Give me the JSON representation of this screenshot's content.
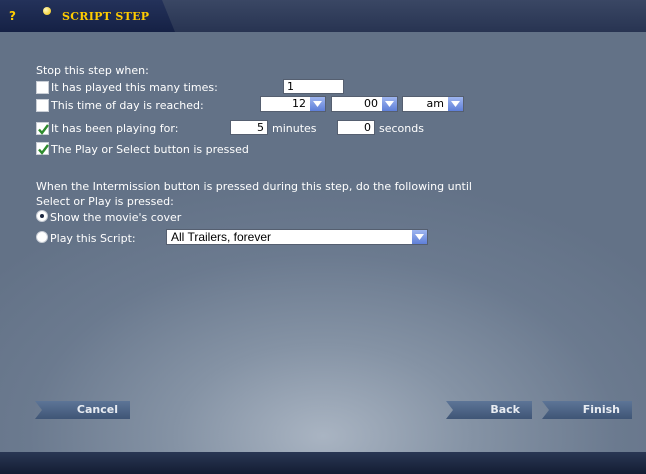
{
  "title": {
    "text": "SCRIPT STEP",
    "help_label": "?"
  },
  "stop_section": {
    "heading": "Stop this step when:",
    "played_times": {
      "label": "It has played this many times:",
      "checked": false,
      "value": "1"
    },
    "time_of_day": {
      "label": "This time of day is reached:",
      "checked": false,
      "hour": "12",
      "minute": "00",
      "ampm": "am"
    },
    "playing_for": {
      "label": "It has been playing for:",
      "checked": true,
      "minutes_value": "5",
      "minutes_label": "minutes",
      "seconds_value": "0",
      "seconds_label": "seconds"
    },
    "button_pressed": {
      "label": "The Play or Select button is pressed",
      "checked": true
    }
  },
  "intermission": {
    "line1": "When the Intermission button is pressed during this step, do the following until",
    "line2": "Select or Play is pressed:",
    "option_cover": {
      "label": "Show the movie's cover",
      "selected": true
    },
    "option_script": {
      "label": "Play this Script:",
      "selected": false,
      "value": "All Trailers, forever"
    }
  },
  "buttons": {
    "cancel": "Cancel",
    "back": "Back",
    "finish": "Finish"
  },
  "colors": {
    "accent": "#ffcc00",
    "title_bar": "#283452",
    "background": "#6b7a8f",
    "button": "#4a6285",
    "check": "#2e8b2e"
  }
}
